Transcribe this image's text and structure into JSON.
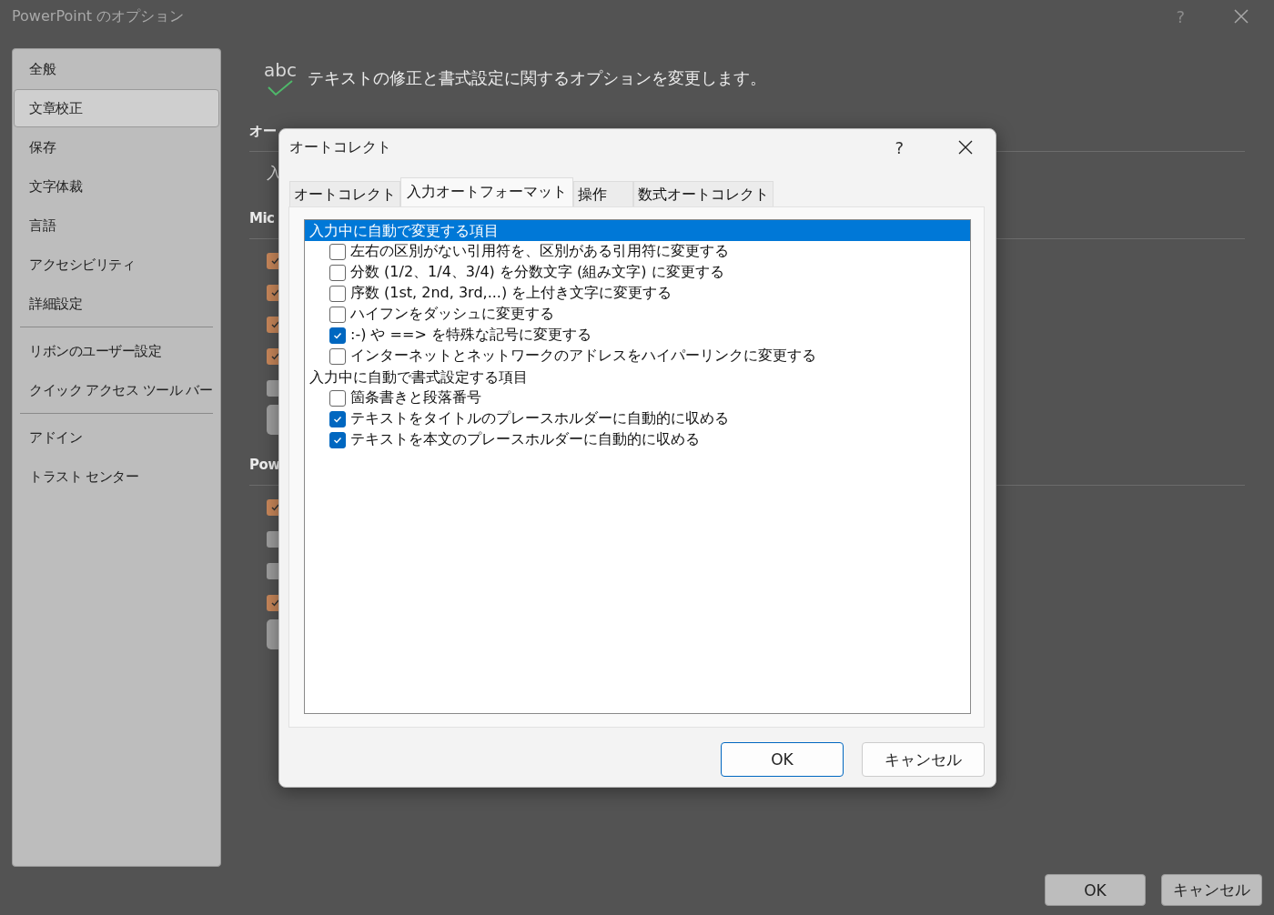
{
  "window": {
    "title": "PowerPoint のオプション",
    "help_label": "?"
  },
  "sidebar": {
    "groups": [
      [
        {
          "label": "全般",
          "selected": false
        },
        {
          "label": "文章校正",
          "selected": true
        },
        {
          "label": "保存",
          "selected": false
        },
        {
          "label": "文字体裁",
          "selected": false
        },
        {
          "label": "言語",
          "selected": false
        },
        {
          "label": "アクセシビリティ",
          "selected": false
        },
        {
          "label": "詳細設定",
          "selected": false
        }
      ],
      [
        {
          "label": "リボンのユーザー設定",
          "selected": false
        },
        {
          "label": "クイック アクセス ツール バー",
          "selected": false
        }
      ],
      [
        {
          "label": "アドイン",
          "selected": false
        },
        {
          "label": "トラスト センター",
          "selected": false
        }
      ]
    ]
  },
  "header": {
    "icon_label": "abc",
    "text": "テキストの修正と書式設定に関するオプションを変更します。"
  },
  "sections": [
    {
      "title": "オー",
      "rows": [
        {
          "kind": "text",
          "text": "入"
        }
      ]
    },
    {
      "title": "Mic",
      "rows": [
        {
          "kind": "checkbox",
          "checked": true
        },
        {
          "kind": "checkbox",
          "checked": true
        },
        {
          "kind": "checkbox",
          "checked": true
        },
        {
          "kind": "checkbox",
          "checked": true
        },
        {
          "kind": "checkbox",
          "checked": false
        },
        {
          "kind": "button"
        }
      ]
    },
    {
      "title": "Pow",
      "rows": [
        {
          "kind": "checkbox",
          "checked": true
        },
        {
          "kind": "checkbox",
          "checked": false
        },
        {
          "kind": "checkbox",
          "checked": false
        },
        {
          "kind": "checkbox",
          "checked": true
        },
        {
          "kind": "button"
        }
      ]
    }
  ],
  "buttons": [
    "OK",
    "キャンセル"
  ],
  "dialog": {
    "title": "オートコレクト",
    "help_label": "?",
    "tabs": [
      {
        "label": "オートコレクト",
        "selected": false
      },
      {
        "label": "入力オートフォーマット",
        "selected": true
      },
      {
        "label": "操作",
        "selected": false
      },
      {
        "label": "数式オートコレクト",
        "selected": false
      }
    ],
    "list": [
      {
        "kind": "heading",
        "text": "入力中に自動で変更する項目",
        "selected": true
      },
      {
        "kind": "option",
        "text": "左右の区別がない引用符を、区別がある引用符に変更する",
        "checked": false,
        "selected": false
      },
      {
        "kind": "option",
        "text": "分数 (1/2、1/4、3/4) を分数文字 (組み文字) に変更する",
        "checked": false,
        "selected": false
      },
      {
        "kind": "option",
        "text": "序数 (1st, 2nd, 3rd,...) を上付き文字に変更する",
        "checked": false,
        "selected": false
      },
      {
        "kind": "option",
        "text": "ハイフンをダッシュに変更する",
        "checked": false,
        "selected": false
      },
      {
        "kind": "option",
        "text": ":-) や ==> を特殊な記号に変更する",
        "checked": true,
        "selected": false
      },
      {
        "kind": "option",
        "text": "インターネットとネットワークのアドレスをハイパーリンクに変更する",
        "checked": false,
        "selected": false
      },
      {
        "kind": "heading",
        "text": "入力中に自動で書式設定する項目",
        "selected": false
      },
      {
        "kind": "option",
        "text": "箇条書きと段落番号",
        "checked": false,
        "selected": false
      },
      {
        "kind": "option",
        "text": "テキストをタイトルのプレースホルダーに自動的に収める",
        "checked": true,
        "selected": false
      },
      {
        "kind": "option",
        "text": "テキストを本文のプレースホルダーに自動的に収める",
        "checked": true,
        "selected": false
      }
    ],
    "buttons": [
      "OK",
      "キャンセル"
    ]
  }
}
